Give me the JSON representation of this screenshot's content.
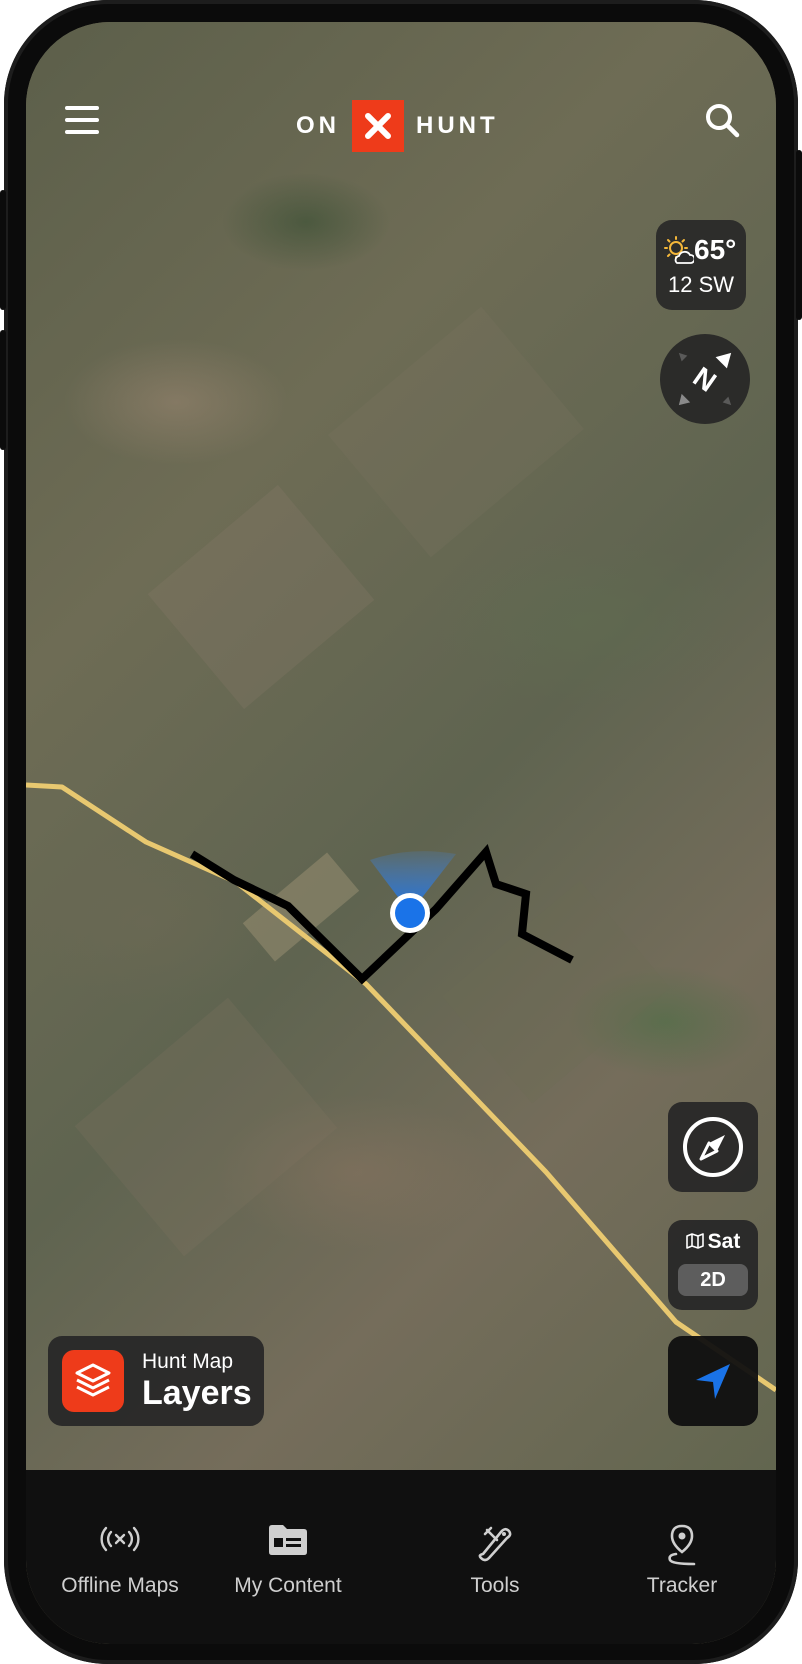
{
  "header": {
    "menu_icon": "hamburger-menu-icon",
    "logo_left": "ON",
    "logo_right": "HUNT",
    "search_icon": "search-icon"
  },
  "weather": {
    "temperature": "65°",
    "wind": "12 SW",
    "icon": "partly-sunny-icon"
  },
  "map_controls": {
    "orientation_icon": "north-arrow-icon",
    "compass_icon": "compass-icon",
    "basemap": {
      "label": "Sat",
      "mode": "2D",
      "icon": "map-icon"
    },
    "locate_icon": "navigation-arrow-icon"
  },
  "layers_button": {
    "small_label": "Hunt Map",
    "big_label": "Layers",
    "icon": "layers-icon"
  },
  "tabs": [
    {
      "label": "Offline Maps",
      "icon": "offline-signal-icon"
    },
    {
      "label": "My Content",
      "icon": "folder-icon"
    },
    {
      "label": "Tools",
      "icon": "tools-icon"
    },
    {
      "label": "Tracker",
      "icon": "tracker-pin-icon"
    }
  ],
  "colors": {
    "brand_orange": "#EE3B1A",
    "location_blue": "#1A73E8",
    "road_yellow": "#E8C870",
    "track_black": "#000000"
  }
}
